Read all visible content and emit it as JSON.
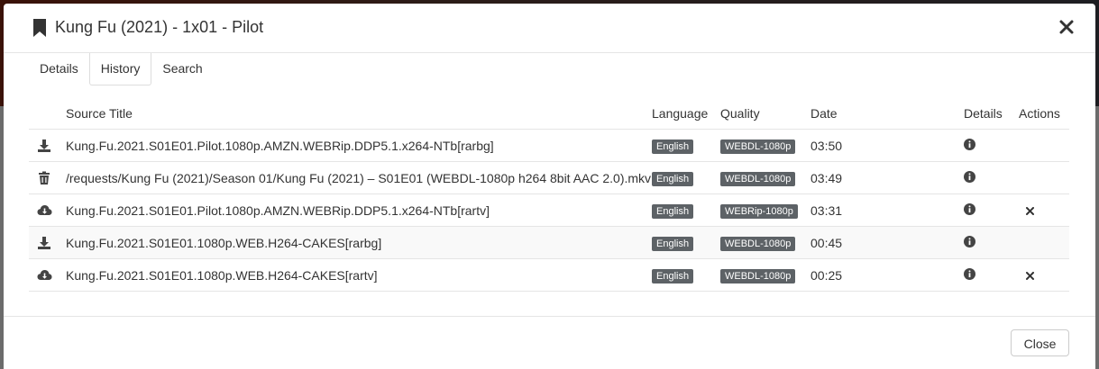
{
  "modal": {
    "title": "Kung Fu (2021) - 1x01 - Pilot",
    "close_label": "Close"
  },
  "tabs": [
    {
      "label": "Details",
      "active": false
    },
    {
      "label": "History",
      "active": true
    },
    {
      "label": "Search",
      "active": false
    }
  ],
  "table": {
    "columns": [
      "",
      "Source Title",
      "Language",
      "Quality",
      "Date",
      "Details",
      "Actions"
    ],
    "rows": [
      {
        "icon": "download-icon",
        "source_title": "Kung.Fu.2021.S01E01.Pilot.1080p.AMZN.WEBRip.DDP5.1.x264-NTb[rarbg]",
        "language": "English",
        "quality": "WEBDL-1080p",
        "date": "03:50",
        "has_action": false
      },
      {
        "icon": "trash-icon",
        "source_title": "/requests/Kung Fu (2021)/Season 01/Kung Fu (2021) – S01E01 (WEBDL-1080p h264 8bit AAC 2.0).mkv",
        "language": "English",
        "quality": "WEBDL-1080p",
        "date": "03:49",
        "has_action": false
      },
      {
        "icon": "cloud-download-icon",
        "source_title": "Kung.Fu.2021.S01E01.Pilot.1080p.AMZN.WEBRip.DDP5.1.x264-NTb[rartv]",
        "language": "English",
        "quality": "WEBRip-1080p",
        "date": "03:31",
        "has_action": true
      },
      {
        "icon": "download-icon",
        "source_title": "Kung.Fu.2021.S01E01.1080p.WEB.H264-CAKES[rarbg]",
        "language": "English",
        "quality": "WEBDL-1080p",
        "date": "00:45",
        "has_action": false
      },
      {
        "icon": "cloud-download-icon",
        "source_title": "Kung.Fu.2021.S01E01.1080p.WEB.H264-CAKES[rartv]",
        "language": "English",
        "quality": "WEBDL-1080p",
        "date": "00:25",
        "has_action": true
      }
    ]
  },
  "colors": {
    "label_bg": "#5d6266",
    "stripe": "#f9f9f9"
  }
}
